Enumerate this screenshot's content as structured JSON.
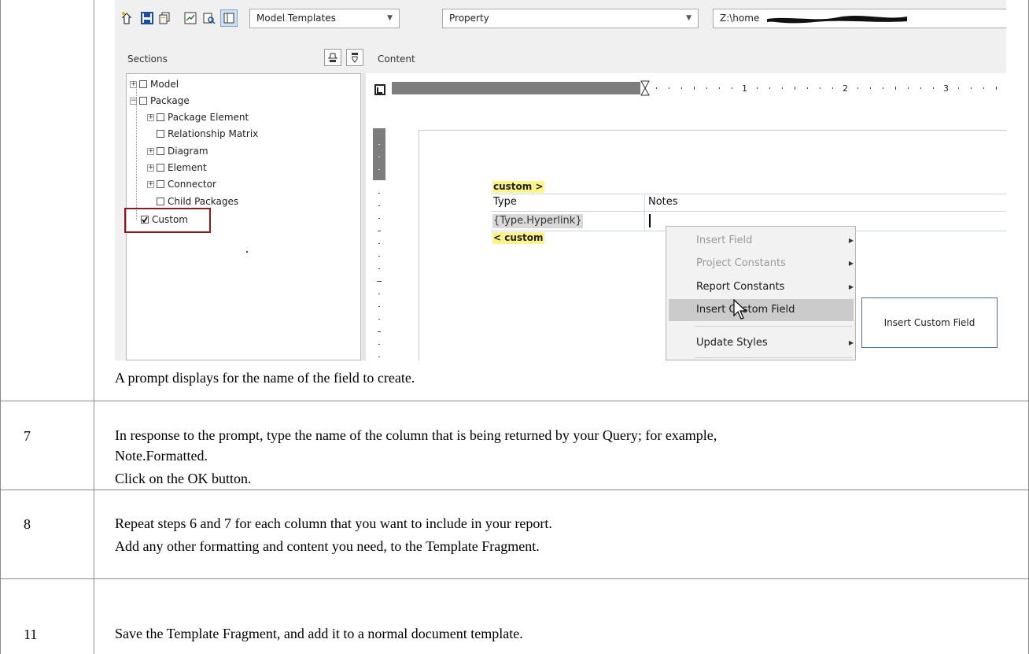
{
  "screenshot": {
    "toolbar": {
      "template_combo": "Model Templates",
      "property_combo": "Property",
      "path_field": "Z:\\home"
    },
    "sections_label": "Sections",
    "content_label": "Content",
    "tree": [
      {
        "label": "Model",
        "expander": "+",
        "checked": false
      },
      {
        "label": "Package",
        "expander": "-",
        "checked": false
      },
      {
        "label": "Package Element",
        "expander": "+",
        "checked": false
      },
      {
        "label": "Relationship Matrix",
        "expander": "",
        "checked": false
      },
      {
        "label": "Diagram",
        "expander": "+",
        "checked": false
      },
      {
        "label": "Element",
        "expander": "+",
        "checked": false
      },
      {
        "label": "Connector",
        "expander": "+",
        "checked": false
      },
      {
        "label": "Child Packages",
        "expander": "",
        "checked": false
      },
      {
        "label": "Custom",
        "expander": "",
        "checked": true
      }
    ],
    "ruler_numbers": [
      "1",
      "2",
      "3"
    ],
    "template": {
      "start_tag": "custom >",
      "col_type": "Type",
      "col_notes": "Notes",
      "field": "{Type.Hyperlink}",
      "end_tag": "< custom"
    },
    "context_menu": [
      {
        "label": "Insert Field",
        "enabled": false,
        "submenu": true
      },
      {
        "label": "Project Constants",
        "enabled": false,
        "submenu": true
      },
      {
        "label": "Report Constants",
        "enabled": true,
        "submenu": true
      },
      {
        "label": "Insert Custom Field",
        "enabled": true,
        "submenu": false,
        "highlighted": true
      },
      {
        "label": "Update Styles",
        "enabled": true,
        "submenu": true
      }
    ],
    "tooltip": "Insert Custom Field"
  },
  "caption": "A prompt displays for the name of the field to create.",
  "steps": [
    {
      "number": "7",
      "lines": [
        "In response to the prompt, type the name of the column that is being returned by your Query; for example,",
        "Note.Formatted.",
        "Click on the OK button."
      ]
    },
    {
      "number": "8",
      "lines": [
        "Repeat steps 6 and 7 for each column that you want to include in your report.",
        "Add any other formatting and content you need, to the Template Fragment."
      ]
    },
    {
      "number": "11",
      "lines": [
        "Save the Template Fragment, and add it to a normal document template."
      ]
    }
  ]
}
